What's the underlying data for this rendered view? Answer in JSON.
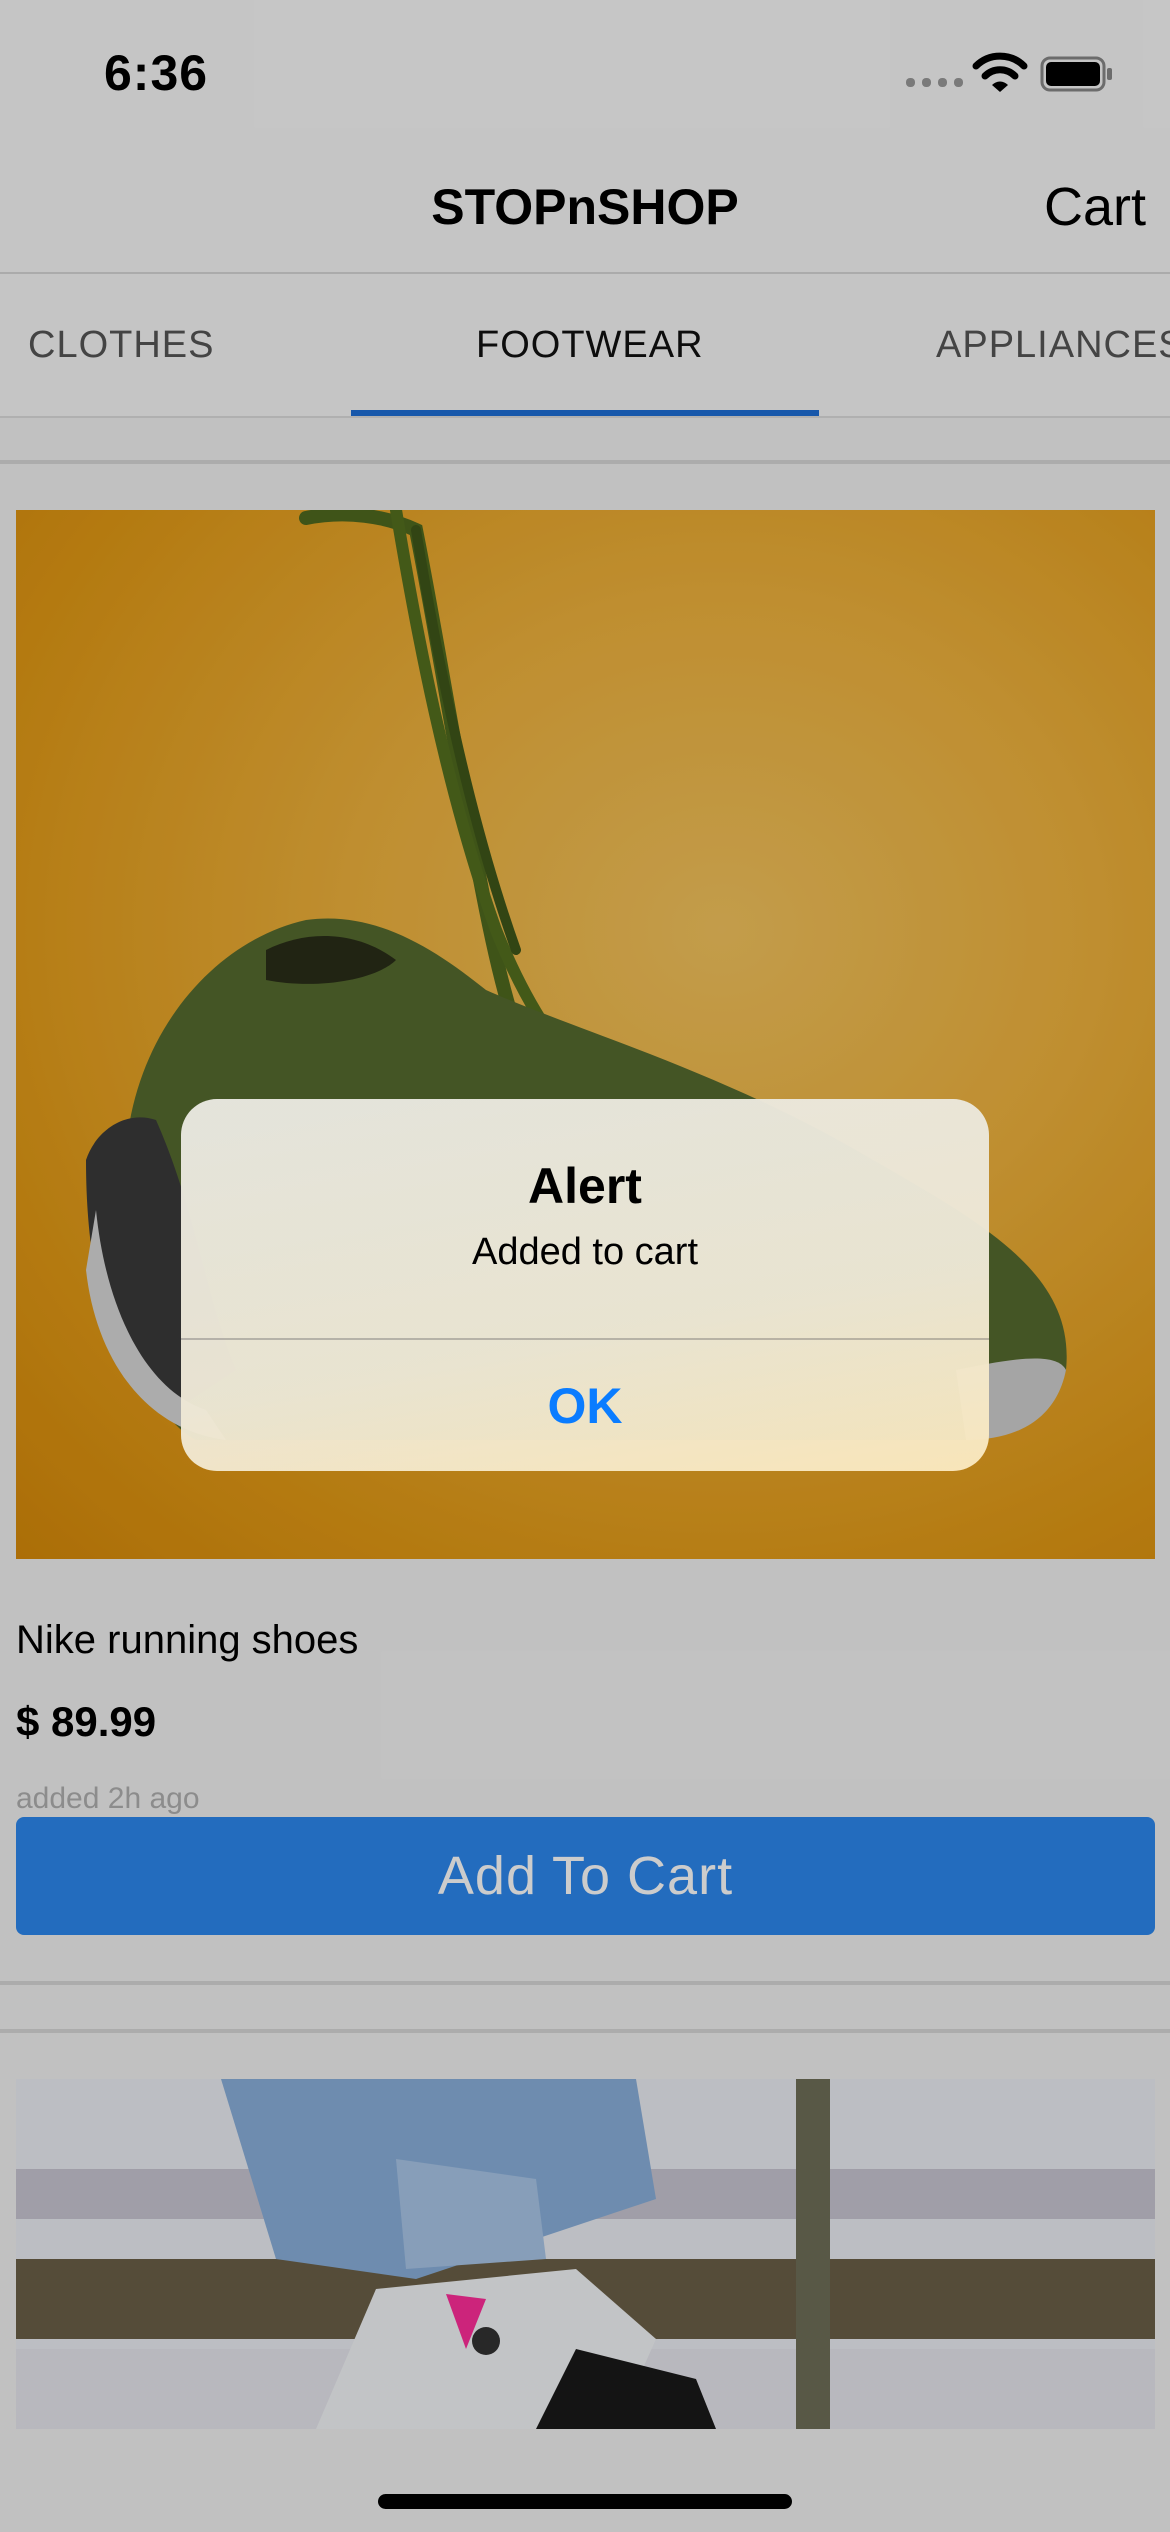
{
  "status_bar": {
    "time": "6:36"
  },
  "header": {
    "title": "STOPnSHOP",
    "cart_label": "Cart"
  },
  "tabs": [
    {
      "label": "CLOTHES",
      "active": false
    },
    {
      "label": "FOOTWEAR",
      "active": true
    },
    {
      "label": "APPLIANCES",
      "active": false
    }
  ],
  "products": [
    {
      "name": "Nike running shoes",
      "price": "$ 89.99",
      "added": "added 2h ago",
      "button_label": "Add To Cart"
    }
  ],
  "alert": {
    "title": "Alert",
    "message": "Added to cart",
    "ok_label": "OK"
  },
  "colors": {
    "accent": "#2c87ee",
    "tab_indicator": "#1f6fd6",
    "alert_button": "#0a7cff",
    "product_image_background": "#e5a322"
  },
  "icons": [
    "cellular-signal-icon",
    "wifi-icon",
    "battery-icon"
  ]
}
